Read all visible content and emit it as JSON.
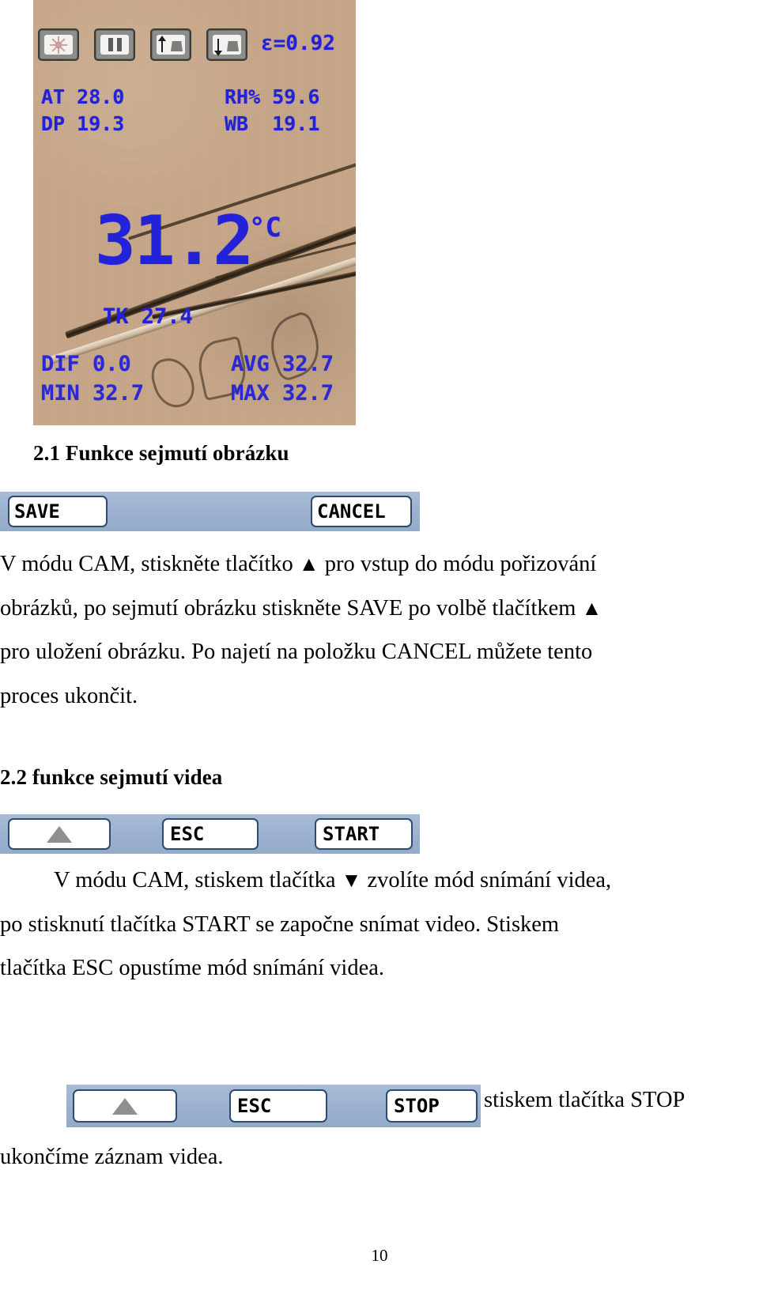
{
  "page": {
    "number": "10",
    "language": "cs"
  },
  "thermal_photo": {
    "icons": [
      {
        "name": "laser-sun-icon",
        "label": "laser"
      },
      {
        "name": "pause-icon",
        "label": "pause"
      },
      {
        "name": "upload-cup-icon",
        "label": "upload"
      },
      {
        "name": "download-cup-icon",
        "label": "download"
      }
    ],
    "readouts": {
      "emissivity": "ε=0.92",
      "ambient_temp": "AT 28.0",
      "dew_point": "DP 19.3",
      "relative_humidity": "RH% 59.6",
      "wet_bulb": "WB  19.1",
      "main_temp": "31.2",
      "unit": "°C",
      "tk": "TK 27.4",
      "dif": "DIF 0.0",
      "avg": "AVG 32.7",
      "min": "MIN 32.7",
      "max": "MAX 32.7"
    },
    "lcd_color": "#2222d8",
    "background_color": "#c8a788"
  },
  "sections": {
    "s21": {
      "heading": "2.1 Funkce sejmutí obrázku",
      "menubar": {
        "save_label": "SAVE",
        "cancel_label": "CANCEL",
        "bar_color": "#9cb2cf"
      },
      "paragraph": {
        "line1a": "V módu CAM, stiskněte tlačítko",
        "line1_arrow": "▲",
        "line1b": "pro vstup do módu pořizování",
        "line2a": "obrázků, po sejmutí obrázku stiskněte SAVE po volbě tlačítkem",
        "line2_arrow": "▲",
        "line3": "pro uložení obrázku. Po najetí na položku CANCEL můžete tento",
        "line4": "proces ukončit."
      }
    },
    "s22": {
      "heading": "2.2 funkce sejmutí videa",
      "menubar_start": {
        "up_label": "▲",
        "esc_label": "ESC",
        "start_label": "START",
        "bar_color": "#9cb2cf"
      },
      "paragraph": {
        "line1a": "V módu CAM, stiskem tlačítka",
        "line1_arrow": "▼",
        "line1b": "zvolíte mód snímání videa,",
        "line2": "po stisknutí tlačítka START se započne snímat video. Stiskem",
        "line3": "tlačítka ESC opustíme mód snímání videa."
      },
      "menubar_stop": {
        "up_label": "▲",
        "esc_label": "ESC",
        "stop_label": "STOP",
        "bar_color": "#9cb2cf"
      },
      "closing": {
        "line1": "stiskem tlačítka STOP",
        "line2": "ukončíme záznam videa."
      }
    }
  }
}
